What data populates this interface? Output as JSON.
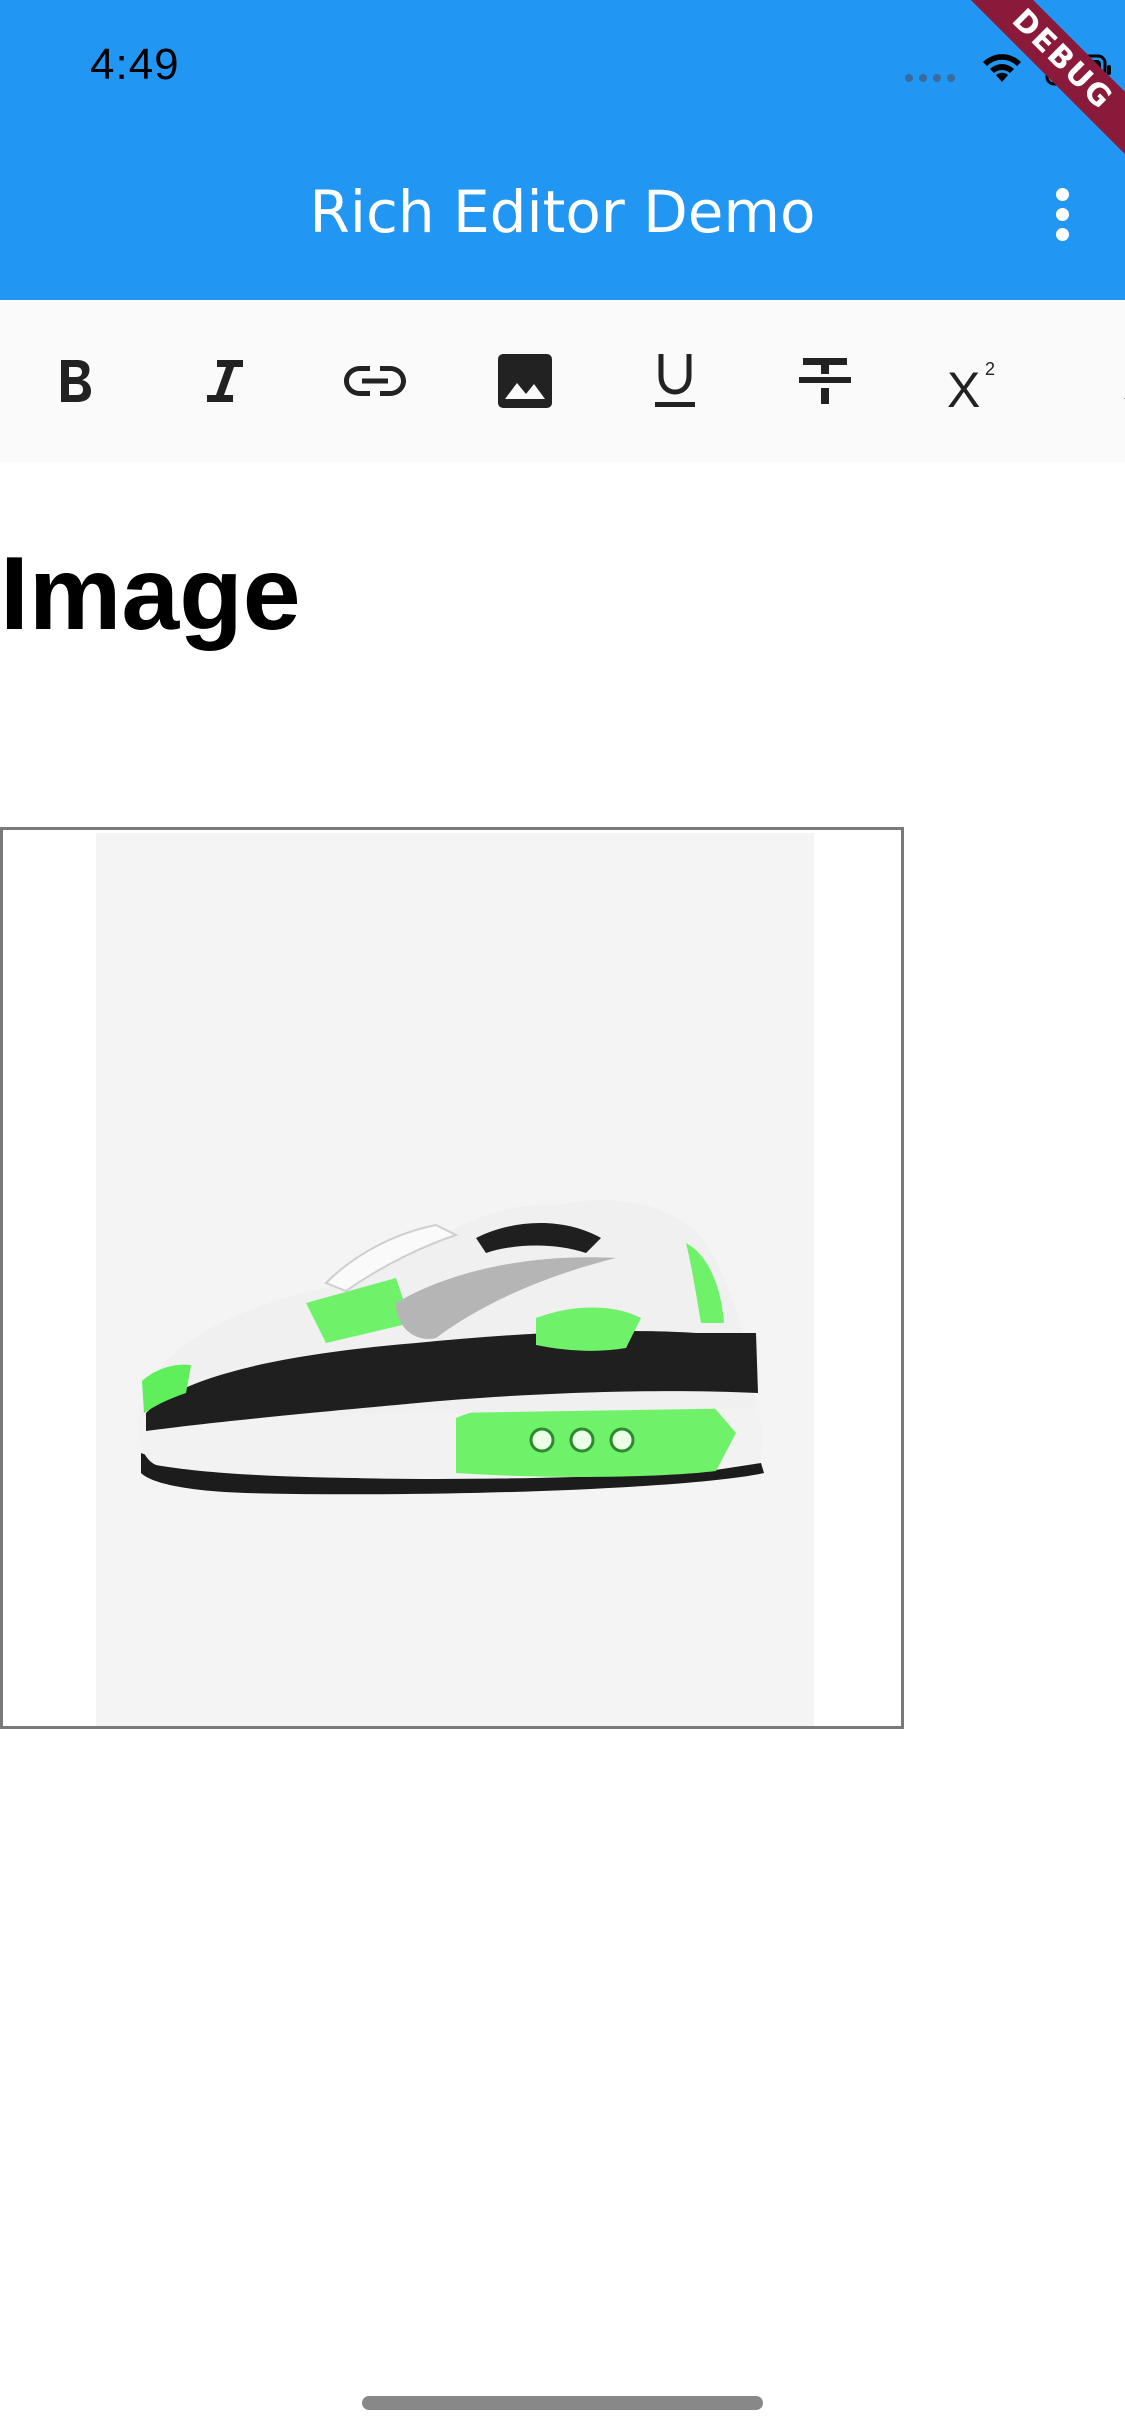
{
  "status_bar": {
    "time": "4:49"
  },
  "app_bar": {
    "title": "Rich Editor Demo",
    "debug_banner": "DEBUG",
    "menu_icon": "more-vert-icon",
    "color": "#2196F3"
  },
  "toolbar": {
    "background": "#fafafa",
    "items": [
      {
        "icon": "bold-icon"
      },
      {
        "icon": "italic-icon"
      },
      {
        "icon": "link-icon"
      },
      {
        "icon": "image-icon"
      },
      {
        "icon": "underline-icon"
      },
      {
        "icon": "strikethrough-icon"
      },
      {
        "icon": "superscript-icon"
      },
      {
        "icon": "subscript-icon"
      }
    ]
  },
  "editor": {
    "heading": "Image",
    "image_alt": "Sneaker product image"
  }
}
